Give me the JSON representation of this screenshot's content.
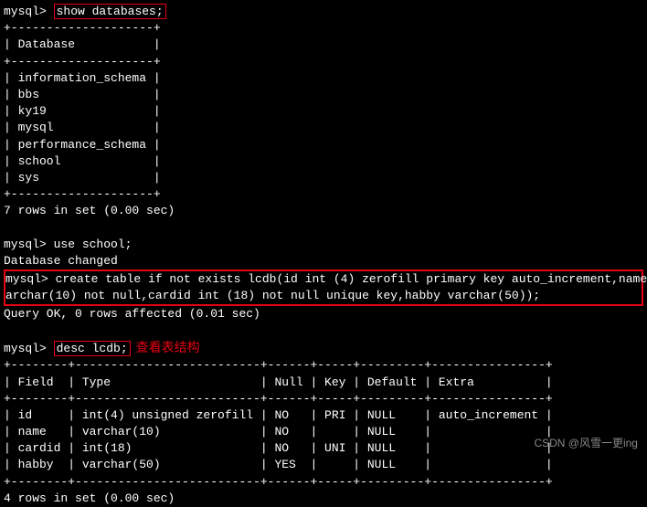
{
  "prompt": "mysql>",
  "cmd_show": "show databases;",
  "table_db": {
    "sep_top": "+--------------------+",
    "header": "| Database           |",
    "sep_mid": "+--------------------+",
    "rows": [
      "| information_schema |",
      "| bbs                |",
      "| ky19               |",
      "| mysql              |",
      "| performance_schema |",
      "| school             |",
      "| sys                |"
    ],
    "sep_bot": "+--------------------+",
    "summary": "7 rows in set (0.00 sec)"
  },
  "cmd_use": "use school;",
  "use_result": "Database changed",
  "create_line1_prefix": "mysql> ",
  "create_body_line1": "create table if not exists lcdb(id int (4) zerofill primary key auto_increment,name ",
  "create_body_line2": "archar(10) not null,cardid int (18) not null unique key,habby varchar(50));",
  "create_result": "Query OK, 0 rows affected (0.01 sec)",
  "cmd_desc": "desc lcdb;",
  "annotation_desc": "查看表结构",
  "desc_table": {
    "sep_top": "+--------+--------------------------+------+-----+---------+----------------+",
    "header": "| Field  | Type                     | Null | Key | Default | Extra          |",
    "sep_mid": "+--------+--------------------------+------+-----+---------+----------------+",
    "rows": [
      "| id     | int(4) unsigned zerofill | NO   | PRI | NULL    | auto_increment |",
      "| name   | varchar(10)              | NO   |     | NULL    |                |",
      "| cardid | int(18)                  | NO   | UNI | NULL    |                |",
      "| habby  | varchar(50)              | YES  |     | NULL    |                |"
    ],
    "sep_bot": "+--------+--------------------------+------+-----+---------+----------------+",
    "summary": "4 rows in set (0.00 sec)"
  },
  "watermark": "CSDN @风雪一更ing",
  "chart_data": {
    "type": "table",
    "title": "desc lcdb;",
    "columns": [
      "Field",
      "Type",
      "Null",
      "Key",
      "Default",
      "Extra"
    ],
    "rows": [
      [
        "id",
        "int(4) unsigned zerofill",
        "NO",
        "PRI",
        "NULL",
        "auto_increment"
      ],
      [
        "name",
        "varchar(10)",
        "NO",
        "",
        "NULL",
        ""
      ],
      [
        "cardid",
        "int(18)",
        "NO",
        "UNI",
        "NULL",
        ""
      ],
      [
        "habby",
        "varchar(50)",
        "YES",
        "",
        "NULL",
        ""
      ]
    ]
  }
}
